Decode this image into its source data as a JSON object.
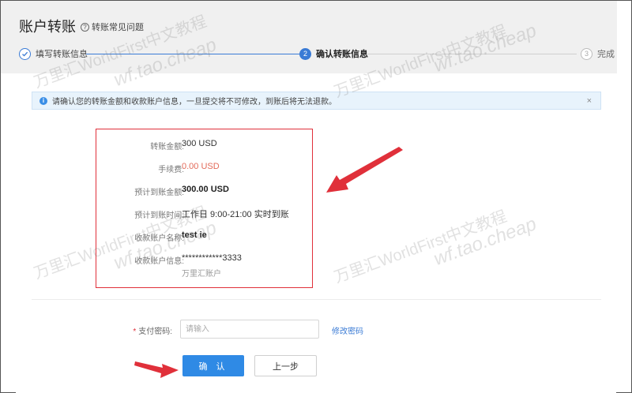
{
  "page": {
    "title": "账户转账",
    "help_link": "转账常见问题",
    "help_icon": "?"
  },
  "steps": [
    {
      "index": "1",
      "label": "填写转账信息",
      "state": "done",
      "icon": "checkmark"
    },
    {
      "index": "2",
      "label": "确认转账信息",
      "state": "active"
    },
    {
      "index": "3",
      "label": "完成",
      "state": "todo"
    }
  ],
  "alert": {
    "icon": "i",
    "text": "请确认您的转账金额和收款账户信息，一旦提交将不可修改，到账后将无法退款。",
    "close": "×"
  },
  "transfer_info": [
    {
      "label": "转账金额:",
      "value": "300 USD"
    },
    {
      "label": "手续费:",
      "value": "0.00 USD"
    },
    {
      "label": "预计到账金额:",
      "value": "300.00 USD"
    },
    {
      "label": "预计到账时间:",
      "value": "工作日 9:00-21:00 实时到账"
    },
    {
      "label": "收款账户名称:",
      "value": "test ie"
    },
    {
      "label": "收款账户信息:",
      "value": "************3333",
      "sub": "万里汇账户"
    }
  ],
  "password": {
    "required_mark": "*",
    "label": "支付密码:",
    "placeholder": "请输入",
    "value": "",
    "change_link": "修改密码"
  },
  "buttons": {
    "confirm": "确 认",
    "previous": "上一步"
  },
  "watermarks": [
    {
      "text": "万里汇WorldFirst中文教程"
    },
    {
      "text": "wf.tao.cheap"
    }
  ],
  "colors": {
    "primary": "#2f8ae5",
    "step_active": "#3a7bd5",
    "fee_red": "#e36b5a",
    "highlight_border": "#e0303a",
    "annotation_arrow": "#e0303a",
    "alert_bg": "#e8f3fc"
  }
}
